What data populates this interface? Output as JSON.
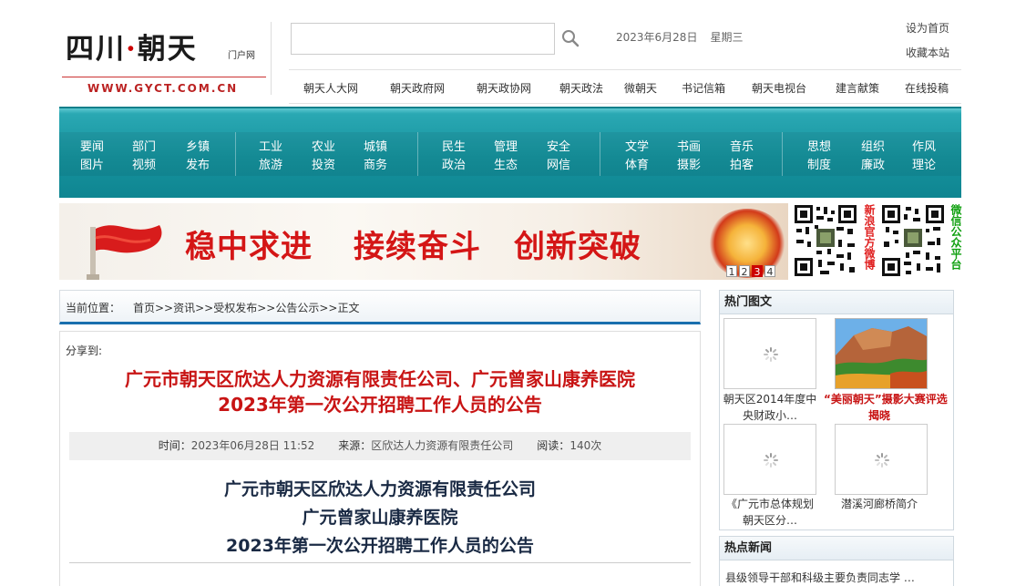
{
  "header": {
    "logo_title_a": "四川",
    "logo_title_dot": "·",
    "logo_title_b": "朝天",
    "logo_sub": "门户网",
    "logo_url": "WWW.GYCT.COM.CN",
    "search_placeholder": "",
    "date": "2023年6月28日",
    "weekday": "星期三",
    "set_home": "设为首页",
    "bookmark": "收藏本站"
  },
  "top_nav": [
    "朝天人大网",
    "朝天政府网",
    "朝天政协网",
    "朝天政法",
    "微朝天",
    "书记信箱",
    "朝天电视台",
    "建言献策",
    "在线投稿"
  ],
  "main_nav": {
    "groups": [
      {
        "row1": [
          "要闻",
          "部门",
          "乡镇"
        ],
        "row2": [
          "图片",
          "视频",
          "发布"
        ]
      },
      {
        "row1": [
          "工业",
          "农业",
          "城镇"
        ],
        "row2": [
          "旅游",
          "投资",
          "商务"
        ]
      },
      {
        "row1": [
          "民生",
          "管理",
          "安全"
        ],
        "row2": [
          "政治",
          "生态",
          "网信"
        ]
      },
      {
        "row1": [
          "文学",
          "书画",
          "音乐"
        ],
        "row2": [
          "体育",
          "摄影",
          "拍客"
        ]
      },
      {
        "row1": [
          "思想",
          "组织",
          "作风"
        ],
        "row2": [
          "制度",
          "廉政",
          "理论"
        ]
      }
    ]
  },
  "banner": {
    "slogans": [
      "稳中求进",
      "接续奋斗",
      "创新突破"
    ],
    "pager": [
      "1",
      "2",
      "3",
      "4"
    ],
    "pager_active": 3
  },
  "qr": {
    "weibo_label": "新浪官方微博",
    "wechat_label": "微信公众平台",
    "weibo_color": "#e02020",
    "wechat_color": "#10a010"
  },
  "breadcrumb": {
    "label": "当前位置：",
    "path": "首页>>资讯>>受权发布>>公告公示>>正文"
  },
  "article": {
    "share_label": "分享到:",
    "title_line1": "广元市朝天区欣达人力资源有限责任公司、广元曾家山康养医院",
    "title_line2": "2023年第一次公开招聘工作人员的公告",
    "meta": {
      "time_label": "时间：",
      "time": "2023年06月28日 11:52",
      "source_label": "来源：",
      "source": "区欣达人力资源有限责任公司",
      "views_label": "阅读：",
      "views": "140次"
    },
    "body_line1": "广元市朝天区欣达人力资源有限责任公司",
    "body_line2": "广元曾家山康养医院",
    "body_line3": "2023年第一次公开招聘工作人员的公告"
  },
  "sidebar": {
    "hot_pics_title": "热门图文",
    "hot_pics": [
      {
        "caption_line1": "朝天区2014年度中",
        "caption_line2": "央财政小…",
        "highlight": false
      },
      {
        "caption_line1": "“美丽朝天”摄影大赛评选",
        "caption_line2": "揭晓",
        "highlight": true
      },
      {
        "caption_line1": "《广元市总体规划",
        "caption_line2": "朝天区分…",
        "highlight": false
      },
      {
        "caption_line1": "潜溪河廊桥简介",
        "caption_line2": "",
        "highlight": false
      }
    ],
    "hot_news_title": "热点新闻",
    "hot_news": [
      "县级领导干部和科级主要负责同志学 …"
    ]
  },
  "colors": {
    "accent_red": "#c81414",
    "nav_teal": "#16939e",
    "crumb_blue": "#1a6fae"
  }
}
